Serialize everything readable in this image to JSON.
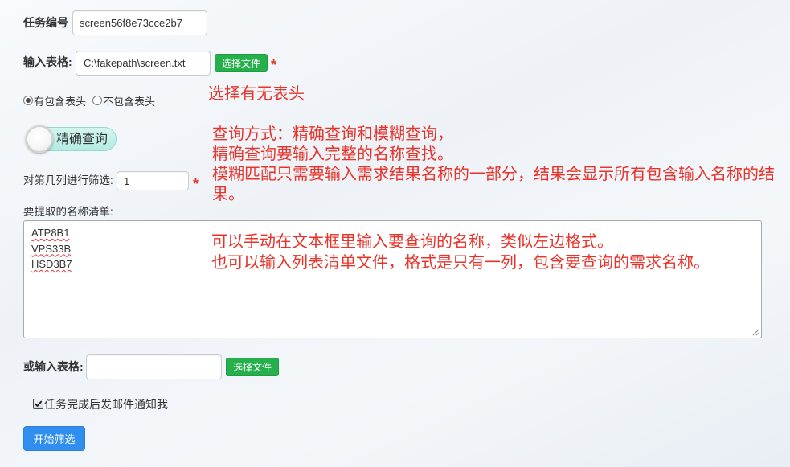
{
  "form": {
    "task_id": {
      "label": "任务编号",
      "value": "screen56f8e73cce2b7"
    },
    "input_table": {
      "label": "输入表格:",
      "file_path": "C:\\fakepath\\screen.txt",
      "button_label": "选择文件",
      "required_mark": "*"
    },
    "header_option": {
      "options": [
        {
          "label": "有包含表头",
          "checked": true
        },
        {
          "label": "不包含表头",
          "checked": false
        }
      ]
    },
    "match_mode_toggle": {
      "label": "精确查询"
    },
    "filter_column": {
      "label": "对第几列进行筛选:",
      "value": "1",
      "required_mark": "*"
    },
    "name_list": {
      "label": "要提取的名称清单:",
      "lines": [
        "ATP8B1",
        "VPS33B",
        "HSD3B7"
      ]
    },
    "alt_table": {
      "label": "或输入表格:",
      "value": "",
      "button_label": "选择文件"
    },
    "email_notify": {
      "label": "任务完成后发邮件通知我",
      "checked": true
    },
    "submit": {
      "label": "开始筛选"
    }
  },
  "annotations": {
    "header_hint": "选择有无表头",
    "query_mode": [
      "查询方式：精确查询和模糊查询，",
      "精确查询要输入完整的名称查找。",
      "模糊匹配只需要输入需求结果名称的一部分，结果会显示所有包含输入名称的结果。"
    ],
    "name_list_hint": [
      "可以手动在文本框里输入要查询的名称，类似左边格式。",
      "也可以输入列表清单文件，格式是只有一列，包含要查询的需求名称。"
    ]
  },
  "colors": {
    "annotation": "#e8332a",
    "required_mark": "#e8332a",
    "file_button": "#25b04b",
    "primary_button": "#2f8ef0",
    "toggle_track": "#b4ebe3"
  }
}
